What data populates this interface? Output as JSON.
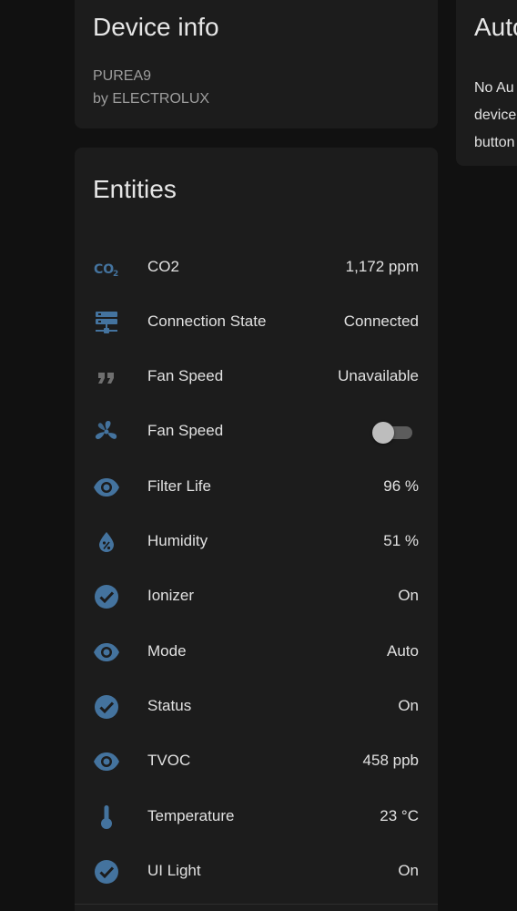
{
  "device_info": {
    "title": "Device info",
    "model": "PUREA9",
    "manufacturer": "by ELECTROLUX"
  },
  "automations": {
    "title": "Auto",
    "line1": "No Au",
    "line2": "device",
    "line3": "button"
  },
  "entities": {
    "title": "Entities",
    "items": [
      {
        "icon": "co2-icon",
        "name": "CO2",
        "state": "1,172 ppm"
      },
      {
        "icon": "server-network-icon",
        "name": "Connection State",
        "state": "Connected"
      },
      {
        "icon": "format-quote-icon",
        "name": "Fan Speed",
        "state": "Unavailable"
      },
      {
        "icon": "fan-icon",
        "name": "Fan Speed",
        "toggle_on": false
      },
      {
        "icon": "eye-icon",
        "name": "Filter Life",
        "state": "96 %"
      },
      {
        "icon": "water-percent-icon",
        "name": "Humidity",
        "state": "51 %"
      },
      {
        "icon": "check-circle-icon",
        "name": "Ionizer",
        "state": "On"
      },
      {
        "icon": "eye-icon",
        "name": "Mode",
        "state": "Auto"
      },
      {
        "icon": "check-circle-icon",
        "name": "Status",
        "state": "On"
      },
      {
        "icon": "eye-icon",
        "name": "TVOC",
        "state": "458 ppb"
      },
      {
        "icon": "thermometer-icon",
        "name": "Temperature",
        "state": "23 °C"
      },
      {
        "icon": "check-circle-icon",
        "name": "UI Light",
        "state": "On"
      }
    ]
  },
  "colors": {
    "icon_blue": "#44739e",
    "icon_grey": "#6f6f6f",
    "card_bg": "#1c1c1c",
    "page_bg": "#111111"
  }
}
